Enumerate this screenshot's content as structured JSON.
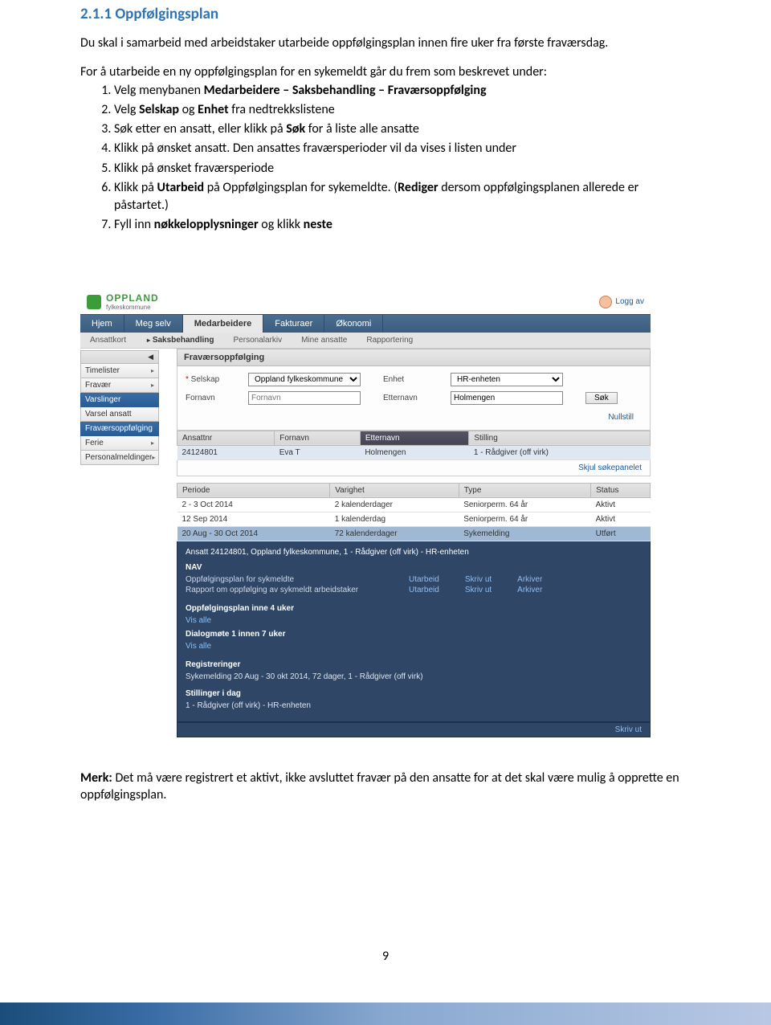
{
  "doc": {
    "section_no_title": "2.1.1   Oppfølgingsplan",
    "intro": "Du skal i samarbeid med arbeidstaker utarbeide oppfølgingsplan innen fire uker fra første fraværsdag.",
    "lead": "For å utarbeide en ny oppfølgingsplan for en sykemeldt går du frem som beskrevet under:",
    "steps": [
      "Velg menybanen <b>Medarbeidere – Saksbehandling – Fraværsoppfølging</b>",
      "Velg <b>Selskap</b> og <b>Enhet</b> fra nedtrekkslistene",
      "Søk etter en ansatt, eller klikk på <b>Søk</b> for å liste alle ansatte",
      "Klikk på ønsket ansatt. Den ansattes fraværsperioder vil da vises i listen under",
      "Klikk på ønsket fraværsperiode",
      "Klikk på <b>Utarbeid</b> på Oppfølgingsplan for sykemeldte. (<b>Rediger</b> dersom oppfølgingsplanen allerede er påstartet.)",
      "Fyll inn <b>nøkkelopplysninger</b> og klikk <b>neste</b>"
    ],
    "note_label": "Merk:",
    "note_text": " Det må være registrert et aktivt, ikke avsluttet fravær på den ansatte for at det skal være mulig å opprette en oppfølgingsplan.",
    "page_number": "9"
  },
  "ss": {
    "logo": {
      "main": "OPPLAND",
      "sub": "fylkeskommune"
    },
    "logout": "Logg av",
    "mainnav": [
      "Hjem",
      "Meg selv",
      "Medarbeidere",
      "Fakturaer",
      "Økonomi"
    ],
    "mainnav_active": 2,
    "subnav": [
      {
        "label": "Ansattkort",
        "arrow": false
      },
      {
        "label": "Saksbehandling",
        "arrow": true,
        "active": true
      },
      {
        "label": "Personalarkiv",
        "arrow": false
      },
      {
        "label": "Mine ansatte",
        "arrow": false
      },
      {
        "label": "Rapportering",
        "arrow": false
      }
    ],
    "sidebar": [
      {
        "label": "Timelister",
        "arrow": true,
        "blue": false
      },
      {
        "label": "Fravær",
        "arrow": true,
        "blue": false
      },
      {
        "label": "Varslinger",
        "arrow": false,
        "blue": true
      },
      {
        "label": "Varsel ansatt",
        "arrow": false,
        "blue": false
      },
      {
        "label": "Fraværsoppfølging",
        "arrow": false,
        "blue": true
      },
      {
        "label": "Ferie",
        "arrow": true,
        "blue": false
      },
      {
        "label": "Personalmeldinger",
        "arrow": true,
        "blue": false
      }
    ],
    "panel_title": "Fraværsoppfølging",
    "search": {
      "selskap_label": "Selskap",
      "selskap_value": "Oppland fylkeskommune",
      "enhet_label": "Enhet",
      "enhet_value": "HR-enheten",
      "fornavn_label": "Fornavn",
      "fornavn_placeholder": "Fornavn",
      "etternavn_label": "Etternavn",
      "etternavn_value": "Holmengen",
      "sok_btn": "Søk",
      "nullstill": "Nullstill"
    },
    "emp_table": {
      "headers": [
        "Ansattnr",
        "Fornavn",
        "Etternavn",
        "Stilling"
      ],
      "dark_col": 2,
      "row": [
        "24124801",
        "Eva T",
        "Holmengen",
        "1 - Rådgiver (off virk)"
      ],
      "hide_panel": "Skjul søkepanelet"
    },
    "period_table": {
      "headers": [
        "Periode",
        "Varighet",
        "Type",
        "Status"
      ],
      "rows": [
        [
          "2 - 3 Oct 2014",
          "2 kalenderdager",
          "Seniorperm. 64 år",
          "Aktivt"
        ],
        [
          "12 Sep 2014",
          "1 kalenderdag",
          "Seniorperm. 64 år",
          "Aktivt"
        ],
        [
          "20 Aug - 30 Oct 2014",
          "72 kalenderdager",
          "Sykemelding",
          "Utført"
        ]
      ],
      "selected_row": 2
    },
    "detail": {
      "header": "Ansatt 24124801, Oppland fylkeskommune, 1 - Rådgiver (off virk) - HR-enheten",
      "nav_label": "NAV",
      "nav_rows": [
        {
          "label": "Oppfølgingsplan for sykmeldte",
          "actions": [
            "Utarbeid",
            "Skriv ut",
            "Arkiver"
          ]
        },
        {
          "label": "Rapport om oppfølging av sykmeldt arbeidstaker",
          "actions": [
            "Utarbeid",
            "Skriv ut",
            "Arkiver"
          ]
        }
      ],
      "plan4_label": "Oppfølgingsplan inne 4 uker",
      "show_all": "Vis alle",
      "dialog7_label": "Dialogmøte 1 innen 7 uker",
      "reg_label": "Registreringer",
      "reg_text": "Sykemelding 20 Aug - 30 okt 2014, 72 dager, 1 - Rådgiver (off virk)",
      "still_label": "Stillinger i dag",
      "still_text": "1 - Rådgiver (off virk) - HR-enheten",
      "print": "Skriv ut"
    }
  }
}
